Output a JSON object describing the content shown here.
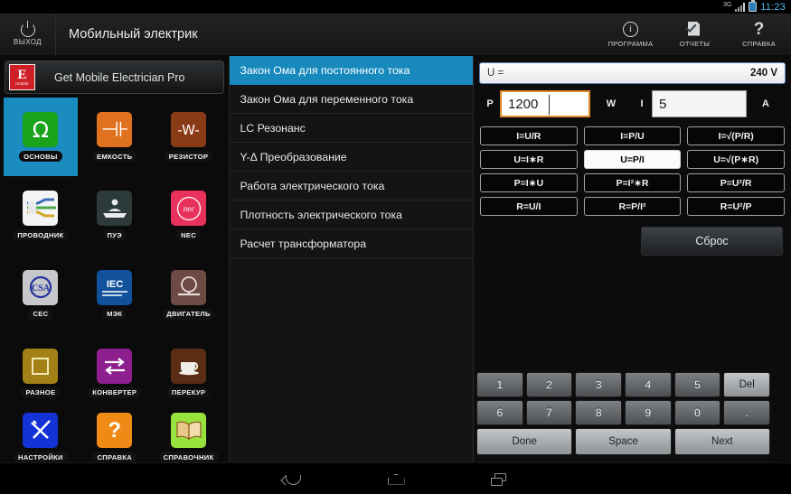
{
  "statusbar": {
    "network": "3G",
    "time": "11:23"
  },
  "actionbar": {
    "exit_label": "ВЫХОД",
    "title": "Мобильный электрик",
    "actions": [
      {
        "label": "ПРОГРАММА",
        "icon": "info-icon"
      },
      {
        "label": "ОТЧЕТЫ",
        "icon": "report-icon"
      },
      {
        "label": "СПРАВКА",
        "icon": "help-icon"
      }
    ]
  },
  "sidebar": {
    "promo": {
      "logo_letter": "E",
      "logo_sub": "mobile",
      "text": "Get Mobile Electrician Pro"
    },
    "tiles": [
      {
        "label": "ОСНОВЫ",
        "icon": "omega-icon",
        "selected": true
      },
      {
        "label": "ЕМКОСТЬ",
        "icon": "capacitor-icon",
        "selected": false
      },
      {
        "label": "РЕЗИСТОР",
        "icon": "resistor-icon",
        "selected": false
      },
      {
        "label": "ПРОВОДНИК",
        "icon": "wire-icon",
        "selected": false
      },
      {
        "label": "ПУЭ",
        "icon": "book-person-icon",
        "selected": false
      },
      {
        "label": "NEC",
        "icon": "nec-icon",
        "selected": false
      },
      {
        "label": "CEC",
        "icon": "csa-icon",
        "selected": false
      },
      {
        "label": "МЭК",
        "icon": "iec-icon",
        "selected": false
      },
      {
        "label": "ДВИГАТЕЛЬ",
        "icon": "motor-icon",
        "selected": false
      },
      {
        "label": "РАЗНОЕ",
        "icon": "square-icon",
        "selected": false
      },
      {
        "label": "КОНВЕРТЕР",
        "icon": "arrows-icon",
        "selected": false
      },
      {
        "label": "ПЕРЕКУР",
        "icon": "coffee-icon",
        "selected": false
      },
      {
        "label": "НАСТРОЙКИ",
        "icon": "tools-icon",
        "selected": false
      },
      {
        "label": "СПРАВКА",
        "icon": "question-icon",
        "selected": false
      },
      {
        "label": "СПРАВОЧНИК",
        "icon": "book-icon",
        "selected": false
      }
    ]
  },
  "list": {
    "items": [
      {
        "label": "Закон Ома для постоянного тока",
        "selected": true
      },
      {
        "label": "Закон Ома для переменного тока",
        "selected": false
      },
      {
        "label": "LC Резонанс",
        "selected": false
      },
      {
        "label": "Y-Δ Преобразование",
        "selected": false
      },
      {
        "label": "Работа электрического тока",
        "selected": false
      },
      {
        "label": "Плотность электрического тока",
        "selected": false
      },
      {
        "label": "Расчет трансформатора",
        "selected": false
      }
    ]
  },
  "calculator": {
    "result": {
      "label": "U =",
      "value": "240 V"
    },
    "fields": [
      {
        "symbol": "P",
        "value": "1200",
        "unit": "W",
        "focused": true
      },
      {
        "symbol": "I",
        "value": "5",
        "unit": "A",
        "focused": false
      }
    ],
    "formulas": [
      {
        "label": "I=U/R",
        "active": false
      },
      {
        "label": "I=P/U",
        "active": false
      },
      {
        "label": "I=√(P/R)",
        "active": false
      },
      {
        "label": "U=I∗R",
        "active": false
      },
      {
        "label": "U=P/I",
        "active": true
      },
      {
        "label": "U=√(P∗R)",
        "active": false
      },
      {
        "label": "P=I∗U",
        "active": false
      },
      {
        "label": "P=I²∗R",
        "active": false
      },
      {
        "label": "P=U²/R",
        "active": false
      },
      {
        "label": "R=U/I",
        "active": false
      },
      {
        "label": "R=P/I²",
        "active": false
      },
      {
        "label": "R=U²/P",
        "active": false
      }
    ],
    "reset_label": "Сброс"
  },
  "keyboard": {
    "row1": [
      "1",
      "2",
      "3",
      "4",
      "5",
      "Del"
    ],
    "row2": [
      "6",
      "7",
      "8",
      "9",
      "0",
      "."
    ],
    "row3": [
      "Done",
      "Space",
      "Next"
    ]
  },
  "navbar": {
    "back": "back-icon",
    "home": "home-icon",
    "recents": "recents-icon"
  }
}
